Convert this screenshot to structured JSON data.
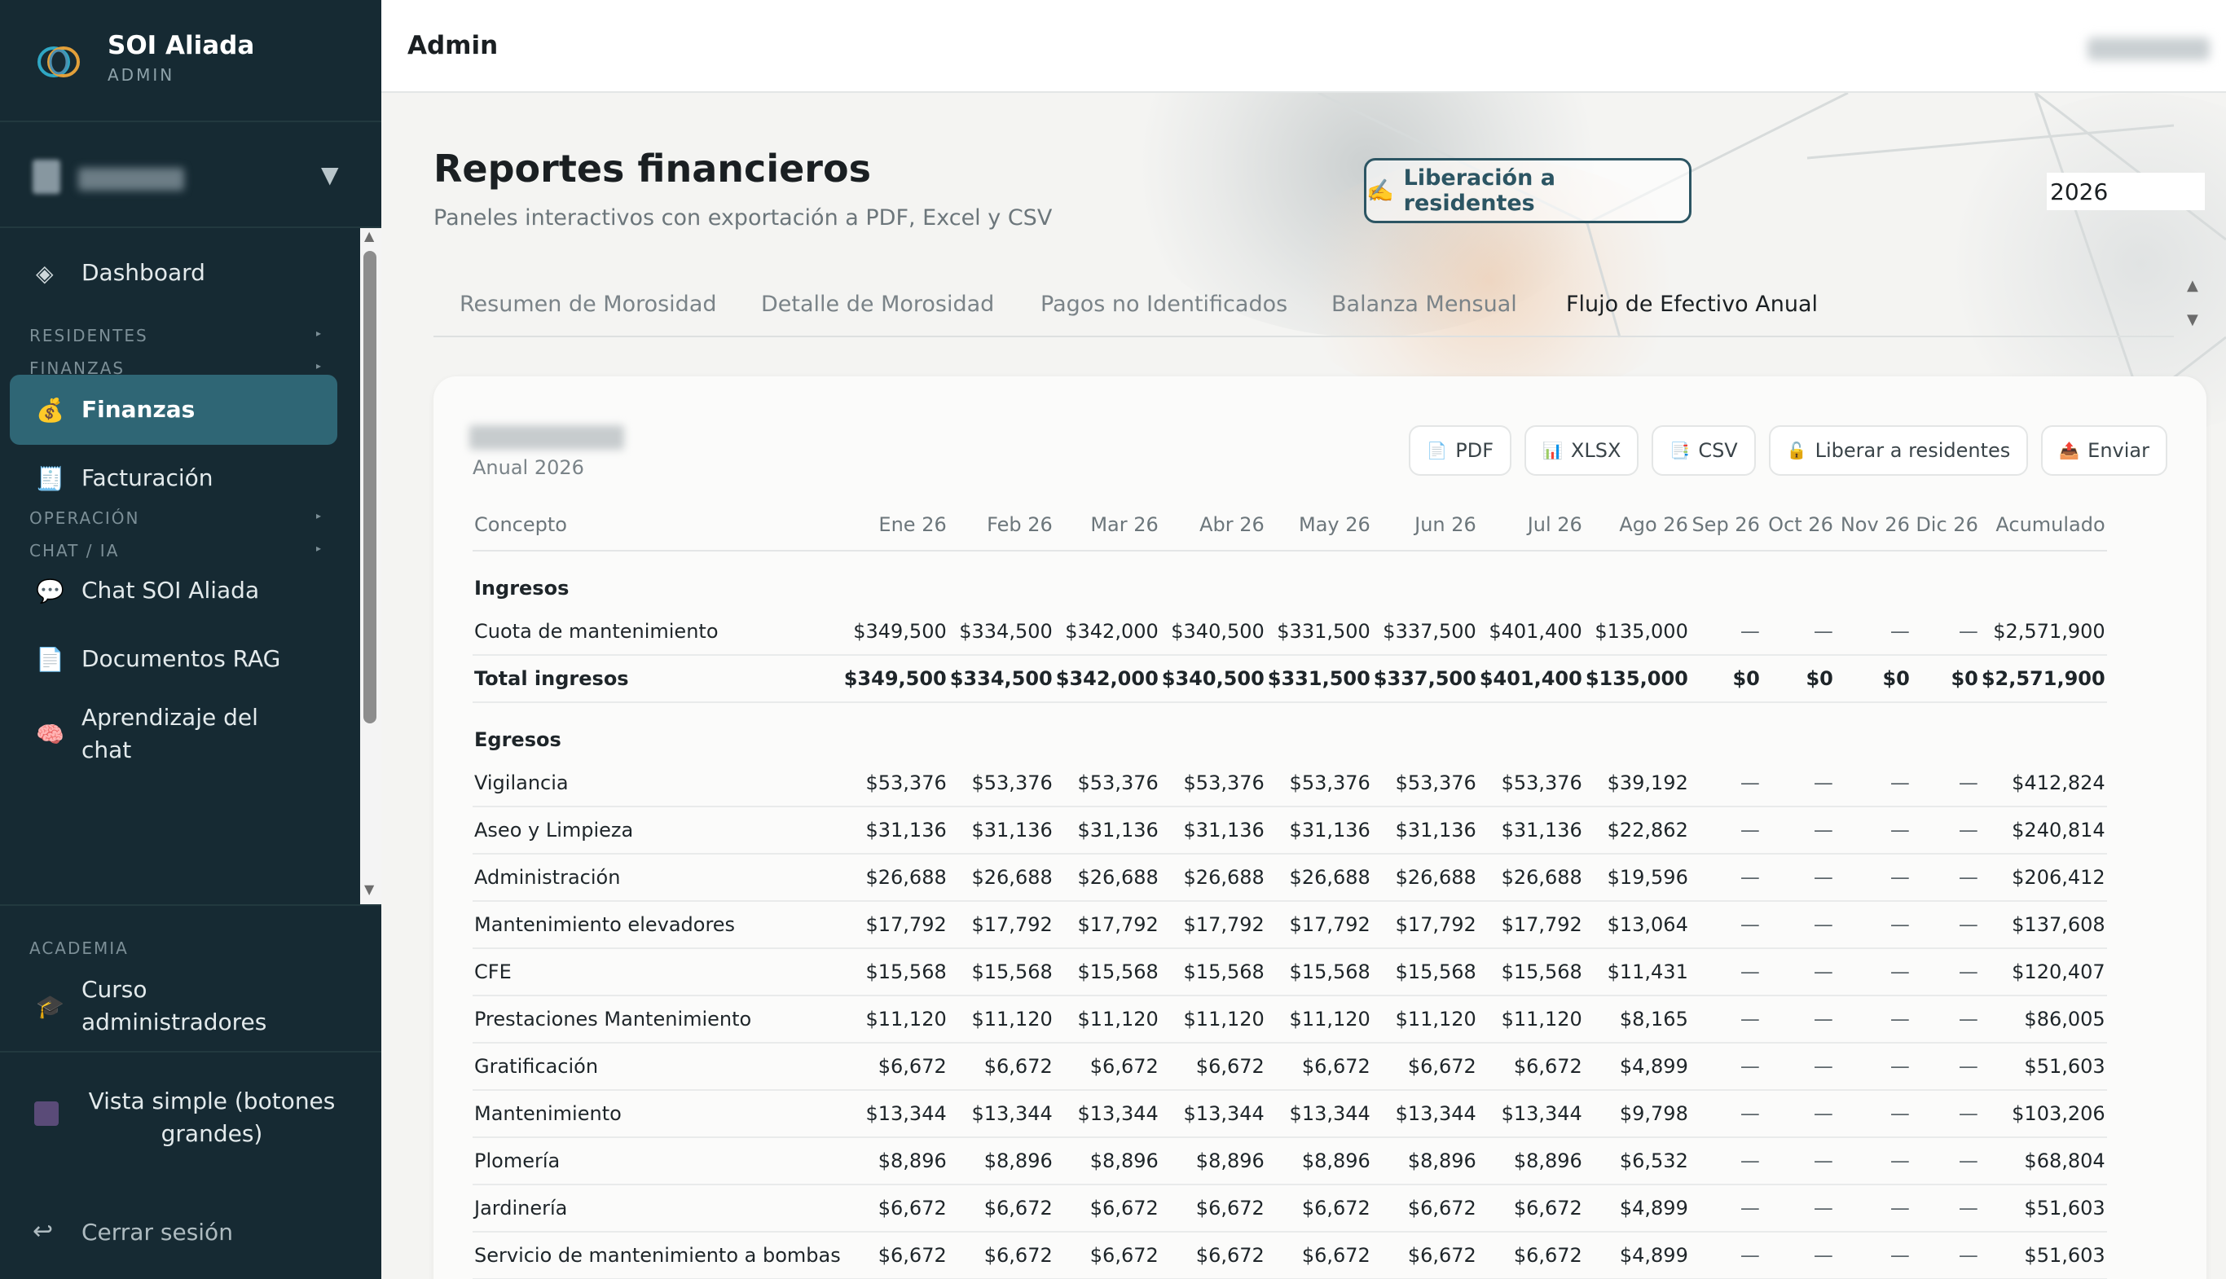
{
  "app": {
    "name": "SOI Aliada",
    "role": "ADMIN"
  },
  "topbar": {
    "title": "Admin"
  },
  "sidebar": {
    "items": [
      {
        "type": "item",
        "icon": "diamond-icon",
        "glyph": "◈",
        "label": "Dashboard"
      },
      {
        "type": "section",
        "label": "RESIDENTES"
      },
      {
        "type": "section",
        "label": "FINANZAS"
      },
      {
        "type": "item",
        "icon": "money-bag-icon",
        "glyph": "💰",
        "label": "Finanzas",
        "active": true
      },
      {
        "type": "item",
        "icon": "receipt-icon",
        "glyph": "🧾",
        "label": "Facturación"
      },
      {
        "type": "section",
        "label": "OPERACIÓN"
      },
      {
        "type": "section",
        "label": "CHAT / IA"
      },
      {
        "type": "item",
        "icon": "chat-bubble-icon",
        "glyph": "💬",
        "label": "Chat SOI Aliada"
      },
      {
        "type": "item",
        "icon": "document-icon",
        "glyph": "📄",
        "label": "Documentos RAG"
      },
      {
        "type": "item",
        "icon": "brain-icon",
        "glyph": "🧠",
        "label": "Aprendizaje del chat"
      }
    ],
    "academia_label": "ACADEMIA",
    "course": {
      "icon": "graduation-cap-icon",
      "glyph": "🎓",
      "label": "Curso administradores"
    },
    "simple_view": "Vista simple (botones grandes)",
    "logout": "Cerrar sesión"
  },
  "page": {
    "title": "Reportes financieros",
    "subtitle": "Paneles interactivos con exportación a PDF, Excel y CSV",
    "release_button": "Liberación a residentes",
    "release_glyph": "✍️",
    "year": "2026"
  },
  "tabs": [
    {
      "label": "Resumen de Morosidad"
    },
    {
      "label": "Detalle de Morosidad"
    },
    {
      "label": "Pagos no Identificados"
    },
    {
      "label": "Balanza Mensual"
    },
    {
      "label": "Flujo de Efectivo Anual",
      "active": true
    }
  ],
  "report": {
    "subtitle": "Anual 2026",
    "exports": [
      {
        "label": "PDF",
        "icon": "pdf-file-icon",
        "glyph": "📄"
      },
      {
        "label": "XLSX",
        "icon": "bar-chart-icon",
        "glyph": "📊"
      },
      {
        "label": "CSV",
        "icon": "csv-file-icon",
        "glyph": "📑"
      },
      {
        "label": "Liberar a residentes",
        "icon": "unlock-icon",
        "glyph": "🔓"
      },
      {
        "label": "Enviar",
        "icon": "outbox-icon",
        "glyph": "📤"
      }
    ],
    "columns": [
      "Concepto",
      "Ene 26",
      "Feb 26",
      "Mar 26",
      "Abr 26",
      "May 26",
      "Jun 26",
      "Jul 26",
      "Ago 26",
      "Sep 26",
      "Oct 26",
      "Nov 26",
      "Dic 26",
      "Acumulado"
    ],
    "rows": [
      {
        "kind": "section",
        "cells": [
          "Ingresos"
        ]
      },
      {
        "kind": "row",
        "cells": [
          "Cuota de mantenimiento",
          "$349,500",
          "$334,500",
          "$342,000",
          "$340,500",
          "$331,500",
          "$337,500",
          "$401,400",
          "$135,000",
          "—",
          "—",
          "—",
          "—",
          "$2,571,900"
        ]
      },
      {
        "kind": "total",
        "cells": [
          "Total ingresos",
          "$349,500",
          "$334,500",
          "$342,000",
          "$340,500",
          "$331,500",
          "$337,500",
          "$401,400",
          "$135,000",
          "$0",
          "$0",
          "$0",
          "$0",
          "$2,571,900"
        ]
      },
      {
        "kind": "section",
        "cells": [
          "Egresos"
        ]
      },
      {
        "kind": "row",
        "cells": [
          "Vigilancia",
          "$53,376",
          "$53,376",
          "$53,376",
          "$53,376",
          "$53,376",
          "$53,376",
          "$53,376",
          "$39,192",
          "—",
          "—",
          "—",
          "—",
          "$412,824"
        ]
      },
      {
        "kind": "row",
        "cells": [
          "Aseo y Limpieza",
          "$31,136",
          "$31,136",
          "$31,136",
          "$31,136",
          "$31,136",
          "$31,136",
          "$31,136",
          "$22,862",
          "—",
          "—",
          "—",
          "—",
          "$240,814"
        ]
      },
      {
        "kind": "row",
        "cells": [
          "Administración",
          "$26,688",
          "$26,688",
          "$26,688",
          "$26,688",
          "$26,688",
          "$26,688",
          "$26,688",
          "$19,596",
          "—",
          "—",
          "—",
          "—",
          "$206,412"
        ]
      },
      {
        "kind": "row",
        "cells": [
          "Mantenimiento elevadores",
          "$17,792",
          "$17,792",
          "$17,792",
          "$17,792",
          "$17,792",
          "$17,792",
          "$17,792",
          "$13,064",
          "—",
          "—",
          "—",
          "—",
          "$137,608"
        ]
      },
      {
        "kind": "row",
        "cells": [
          "CFE",
          "$15,568",
          "$15,568",
          "$15,568",
          "$15,568",
          "$15,568",
          "$15,568",
          "$15,568",
          "$11,431",
          "—",
          "—",
          "—",
          "—",
          "$120,407"
        ]
      },
      {
        "kind": "row",
        "cells": [
          "Prestaciones Mantenimiento",
          "$11,120",
          "$11,120",
          "$11,120",
          "$11,120",
          "$11,120",
          "$11,120",
          "$11,120",
          "$8,165",
          "—",
          "—",
          "—",
          "—",
          "$86,005"
        ]
      },
      {
        "kind": "row",
        "cells": [
          "Gratificación",
          "$6,672",
          "$6,672",
          "$6,672",
          "$6,672",
          "$6,672",
          "$6,672",
          "$6,672",
          "$4,899",
          "—",
          "—",
          "—",
          "—",
          "$51,603"
        ]
      },
      {
        "kind": "row",
        "cells": [
          "Mantenimiento",
          "$13,344",
          "$13,344",
          "$13,344",
          "$13,344",
          "$13,344",
          "$13,344",
          "$13,344",
          "$9,798",
          "—",
          "—",
          "—",
          "—",
          "$103,206"
        ]
      },
      {
        "kind": "row",
        "cells": [
          "Plomería",
          "$8,896",
          "$8,896",
          "$8,896",
          "$8,896",
          "$8,896",
          "$8,896",
          "$8,896",
          "$6,532",
          "—",
          "—",
          "—",
          "—",
          "$68,804"
        ]
      },
      {
        "kind": "row",
        "cells": [
          "Jardinería",
          "$6,672",
          "$6,672",
          "$6,672",
          "$6,672",
          "$6,672",
          "$6,672",
          "$6,672",
          "$4,899",
          "—",
          "—",
          "—",
          "—",
          "$51,603"
        ]
      },
      {
        "kind": "row",
        "cells": [
          "Servicio de mantenimiento a bombas",
          "$6,672",
          "$6,672",
          "$6,672",
          "$6,672",
          "$6,672",
          "$6,672",
          "$6,672",
          "$4,899",
          "—",
          "—",
          "—",
          "—",
          "$51,603"
        ]
      }
    ]
  }
}
